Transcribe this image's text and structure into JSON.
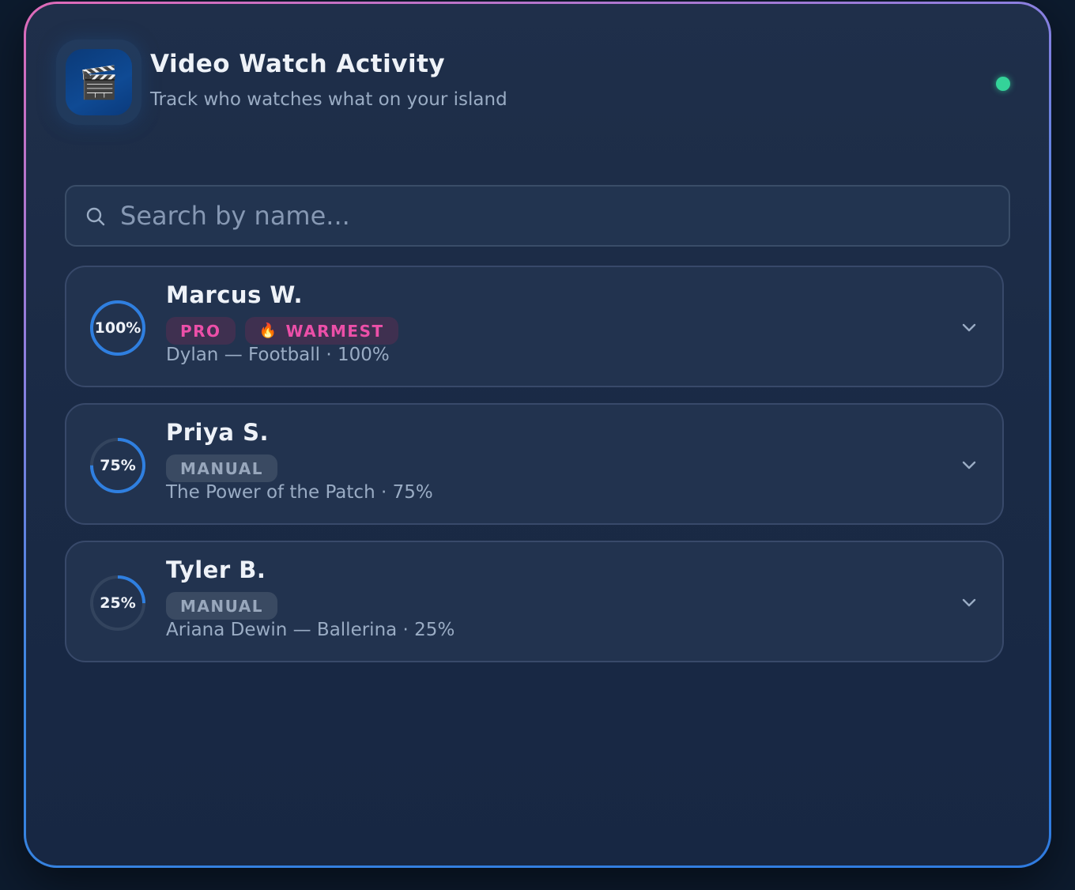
{
  "header": {
    "icon": "clapper-board-icon",
    "icon_glyph": "🎬",
    "title": "Video Watch Activity",
    "subtitle": "Track who watches what on your island",
    "status_color": "#34d399"
  },
  "search": {
    "placeholder": "Search by name...",
    "value": ""
  },
  "colors": {
    "accent_pink": "#ec4fa8",
    "ring_blue": "#2f7fe0",
    "status_green": "#34d399"
  },
  "people": [
    {
      "name": "Marcus W.",
      "progress": 100,
      "progress_label": "100%",
      "badges": [
        {
          "label": "PRO",
          "kind": "pro"
        },
        {
          "label": "WARMEST",
          "kind": "warm",
          "emoji": "🔥"
        }
      ],
      "detail": "Dylan — Football · 100%"
    },
    {
      "name": "Priya S.",
      "progress": 75,
      "progress_label": "75%",
      "badges": [
        {
          "label": "MANUAL",
          "kind": "manual"
        }
      ],
      "detail": "The Power of the Patch · 75%"
    },
    {
      "name": "Tyler B.",
      "progress": 25,
      "progress_label": "25%",
      "badges": [
        {
          "label": "MANUAL",
          "kind": "manual"
        }
      ],
      "detail": "Ariana Dewin — Ballerina · 25%"
    }
  ]
}
